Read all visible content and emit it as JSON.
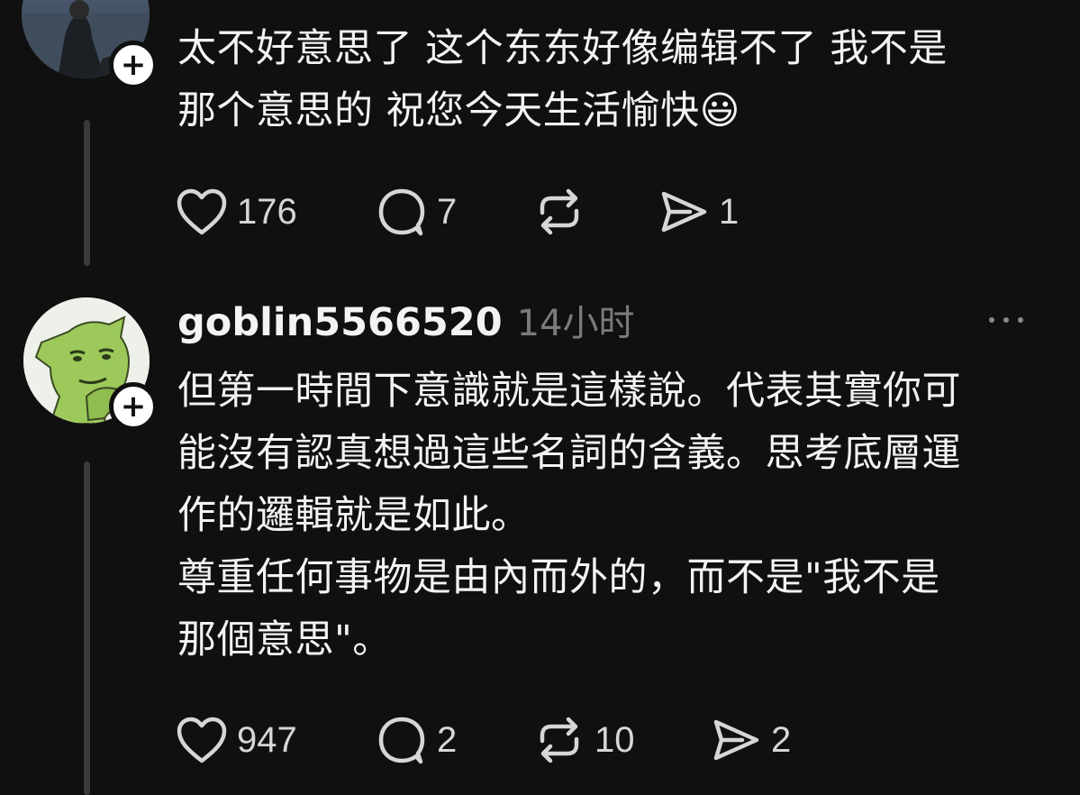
{
  "post1": {
    "text": "太不好意思了 这个东东好像编辑不了 我不是\n那个意思的 祝您今天生活愉快😃",
    "likes": "176",
    "replies": "7",
    "reposts": "",
    "shares": "1"
  },
  "post2": {
    "username": "goblin5566520",
    "timestamp": "14小时",
    "text": "但第一時間下意識就是這樣說。代表其實你可\n能沒有認真想過這些名詞的含義。思考底層運\n作的邏輯就是如此。\n尊重任何事物是由內而外的，而不是\"我不是\n那個意思\"。",
    "likes": "947",
    "replies": "2",
    "reposts": "10",
    "shares": "2"
  },
  "icons": {
    "follow": "plus-icon",
    "like": "heart-icon",
    "reply": "speech-bubble-icon",
    "repost": "repost-icon",
    "share": "send-icon",
    "more": "more-dots-icon"
  },
  "colors": {
    "background": "#101010",
    "text": "#f3f3f3",
    "muted": "#7b7b7b"
  },
  "follow_symbol": "+"
}
